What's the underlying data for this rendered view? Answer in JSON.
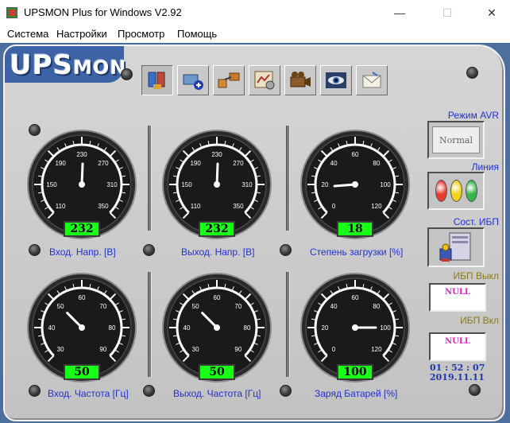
{
  "window": {
    "title": "UPSMON Plus for Windows V2.92",
    "minimize_glyph": "—",
    "maximize_glyph": "☐",
    "close_glyph": "✕"
  },
  "menu": [
    "Система",
    "Настройки",
    "Просмотр",
    "Помощь"
  ],
  "logo": {
    "text_big": "UPS",
    "text_small": "MON"
  },
  "toolbar": {
    "icons": [
      "tools-icon",
      "add-device-icon",
      "network-icon",
      "schedule-icon",
      "camera-icon",
      "eye-icon",
      "mail-icon"
    ],
    "active_index": 0
  },
  "gauges": [
    {
      "label": "Вход. Напр. [В]",
      "ticks": [
        "110",
        "150",
        "190",
        "230",
        "270",
        "310",
        "350"
      ],
      "min": 110,
      "max": 350,
      "value": 232,
      "readout": "232"
    },
    {
      "label": "Выход. Напр. [В]",
      "ticks": [
        "110",
        "150",
        "190",
        "230",
        "270",
        "310",
        "350"
      ],
      "min": 110,
      "max": 350,
      "value": 232,
      "readout": "232"
    },
    {
      "label": "Степень загрузки [%]",
      "ticks": [
        "0",
        "20",
        "40",
        "60",
        "80",
        "100",
        "120"
      ],
      "min": 0,
      "max": 120,
      "value": 18,
      "readout": "18"
    },
    {
      "label": "Вход. Частота [Гц]",
      "ticks": [
        "30",
        "40",
        "50",
        "60",
        "70",
        "80",
        "90"
      ],
      "min": 30,
      "max": 90,
      "value": 50,
      "readout": "50"
    },
    {
      "label": "Выход. Частота [Гц]",
      "ticks": [
        "30",
        "40",
        "50",
        "60",
        "70",
        "80",
        "90"
      ],
      "min": 30,
      "max": 90,
      "value": 50,
      "readout": "50"
    },
    {
      "label": "Заряд Батарей [%]",
      "ticks": [
        "0",
        "20",
        "40",
        "60",
        "80",
        "100",
        "120"
      ],
      "min": 0,
      "max": 120,
      "value": 100,
      "readout": "100"
    }
  ],
  "right": {
    "avr_label": "Режим AVR",
    "avr_value": "Normal",
    "line_label": "Линия",
    "line_leds": [
      "#e83a2e",
      "#f2d21a",
      "#35b54a"
    ],
    "ups_state_label": "Сост. ИБП",
    "ups_off_label": "ИБП Выкл",
    "ups_off_value": "NULL",
    "ups_on_label": "ИБП Вкл",
    "ups_on_value": "NULL",
    "time": "01 : 52 : 07",
    "date": "2019.11.11"
  },
  "colors": {
    "label_blue": "#2030d8",
    "label_olive": "#8a7a20",
    "readout_green": "#18ff18",
    "null_magenta": "#e020d0"
  }
}
